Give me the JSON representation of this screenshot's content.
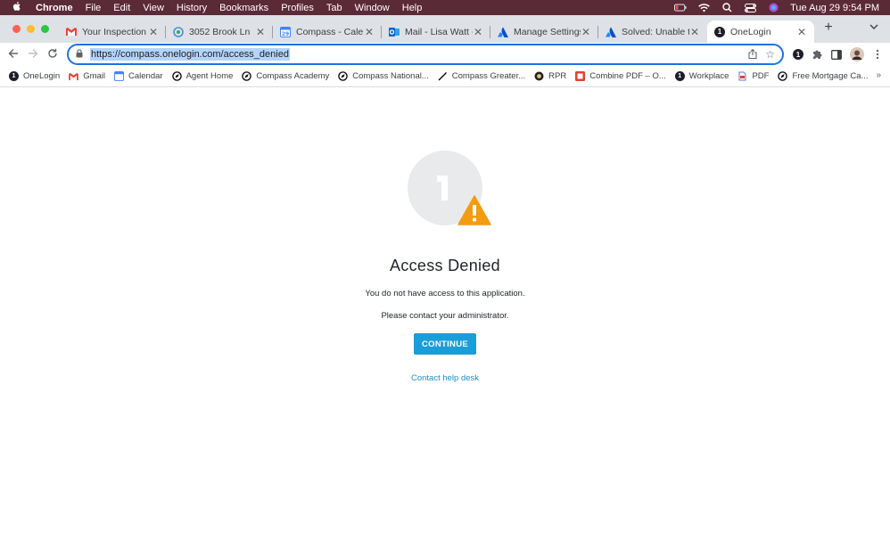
{
  "menubar": {
    "app_name": "Chrome",
    "items": [
      "File",
      "Edit",
      "View",
      "History",
      "Bookmarks",
      "Profiles",
      "Tab",
      "Window",
      "Help"
    ],
    "datetime": "Tue Aug 29  9:54 PM"
  },
  "tabs": [
    {
      "title": "Your Inspection Rep",
      "icon": "gmail-icon",
      "color": "#ea4335"
    },
    {
      "title": "3052 Brook Ln",
      "icon": "location-icon",
      "color": "#4a8fe0"
    },
    {
      "title": "Compass - Calenda",
      "icon": "calendar-icon",
      "color": "#4285f4"
    },
    {
      "title": "Mail - Lisa Watt - O",
      "icon": "outlook-icon",
      "color": "#0a64d2"
    },
    {
      "title": "Manage Settings - ",
      "icon": "atlassian-icon",
      "color": "#2684ff"
    },
    {
      "title": "Solved: Unable to lo",
      "icon": "atlassian-icon",
      "color": "#2684ff"
    },
    {
      "title": "OneLogin",
      "icon": "onelogin-icon",
      "color": "#1c1f2a",
      "active": true
    }
  ],
  "omnibox": {
    "url": "https://compass.onelogin.com/access_denied"
  },
  "bookmarks": [
    {
      "label": "OneLogin",
      "icon": "onelogin-icon"
    },
    {
      "label": "Gmail",
      "icon": "gmail-icon"
    },
    {
      "label": "Calendar",
      "icon": "calendar-icon"
    },
    {
      "label": "Agent Home",
      "icon": "compass-icon"
    },
    {
      "label": "Compass Academy",
      "icon": "compass-icon"
    },
    {
      "label": "Compass National...",
      "icon": "compass-icon"
    },
    {
      "label": "Compass Greater...",
      "icon": "pen-icon"
    },
    {
      "label": "RPR",
      "icon": "rpr-icon"
    },
    {
      "label": "Combine PDF – O...",
      "icon": "pdf-icon"
    },
    {
      "label": "Workplace",
      "icon": "onelogin-icon"
    },
    {
      "label": "PDF",
      "icon": "pdf-icon"
    },
    {
      "label": "Free Mortgage Ca...",
      "icon": "compass-icon"
    }
  ],
  "page": {
    "heading": "Access Denied",
    "message_1": "You do not have access to this application.",
    "message_2": "Please contact your administrator.",
    "continue_label": "CONTINUE",
    "help_link": "Contact help desk"
  },
  "colors": {
    "accent": "#1a9ed9",
    "link": "#1a8fc8",
    "warning": "#f39c12",
    "menubar": "#5a2a36",
    "omnibox_focus": "#1a73e8"
  }
}
